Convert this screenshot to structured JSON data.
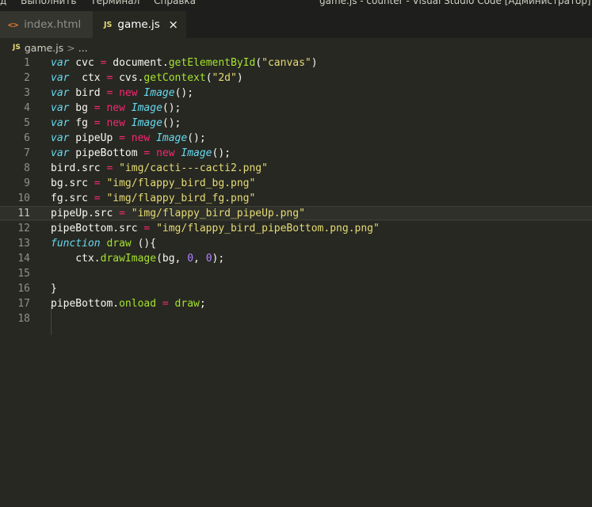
{
  "titlebar": {
    "menu": [
      "д",
      "Выполнить",
      "Терминал",
      "Справка"
    ],
    "window_title": "game.js - counter - Visual Studio Code [Администратор]"
  },
  "tabs": [
    {
      "label": "index.html",
      "icon": "html-file-icon",
      "active": false
    },
    {
      "label": "game.js",
      "icon": "js-file-icon",
      "active": true
    }
  ],
  "breadcrumb": {
    "file": "game.js",
    "icon_text": "JS",
    "sep": ">",
    "rest": "..."
  },
  "file_icons": {
    "html": "<>",
    "js": "JS",
    "close": "×"
  },
  "editor": {
    "current_line": 11,
    "lines": [
      {
        "n": "1",
        "tokens": [
          [
            "k",
            "var"
          ],
          [
            "p",
            " cvc "
          ],
          [
            "o",
            "="
          ],
          [
            "p",
            " document."
          ],
          [
            "f",
            "getElementById"
          ],
          [
            "p",
            "("
          ],
          [
            "s",
            "\"canvas\""
          ],
          [
            "p",
            ")"
          ]
        ]
      },
      {
        "n": "2",
        "tokens": [
          [
            "k",
            "var"
          ],
          [
            "p",
            "  ctx "
          ],
          [
            "o",
            "="
          ],
          [
            "p",
            " cvs."
          ],
          [
            "f",
            "getContext"
          ],
          [
            "p",
            "("
          ],
          [
            "s",
            "\"2d\""
          ],
          [
            "p",
            ")"
          ]
        ]
      },
      {
        "n": "3",
        "tokens": [
          [
            "k",
            "var"
          ],
          [
            "p",
            " bird "
          ],
          [
            "o",
            "="
          ],
          [
            "p",
            " "
          ],
          [
            "n",
            "new"
          ],
          [
            "p",
            " "
          ],
          [
            "c",
            "Image"
          ],
          [
            "p",
            "();"
          ]
        ]
      },
      {
        "n": "4",
        "tokens": [
          [
            "k",
            "var"
          ],
          [
            "p",
            " bg "
          ],
          [
            "o",
            "="
          ],
          [
            "p",
            " "
          ],
          [
            "n",
            "new"
          ],
          [
            "p",
            " "
          ],
          [
            "c",
            "Image"
          ],
          [
            "p",
            "();"
          ]
        ]
      },
      {
        "n": "5",
        "tokens": [
          [
            "k",
            "var"
          ],
          [
            "p",
            " fg "
          ],
          [
            "o",
            "="
          ],
          [
            "p",
            " "
          ],
          [
            "n",
            "new"
          ],
          [
            "p",
            " "
          ],
          [
            "c",
            "Image"
          ],
          [
            "p",
            "();"
          ]
        ]
      },
      {
        "n": "6",
        "tokens": [
          [
            "k",
            "var"
          ],
          [
            "p",
            " pipeUp "
          ],
          [
            "o",
            "="
          ],
          [
            "p",
            " "
          ],
          [
            "n",
            "new"
          ],
          [
            "p",
            " "
          ],
          [
            "c",
            "Image"
          ],
          [
            "p",
            "();"
          ]
        ]
      },
      {
        "n": "7",
        "tokens": [
          [
            "k",
            "var"
          ],
          [
            "p",
            " pipeBottom "
          ],
          [
            "o",
            "="
          ],
          [
            "p",
            " "
          ],
          [
            "n",
            "new"
          ],
          [
            "p",
            " "
          ],
          [
            "c",
            "Image"
          ],
          [
            "p",
            "();"
          ]
        ]
      },
      {
        "n": "8",
        "tokens": [
          [
            "p",
            "bird.src "
          ],
          [
            "o",
            "="
          ],
          [
            "p",
            " "
          ],
          [
            "s",
            "\"img/cacti---cacti2.png\""
          ]
        ]
      },
      {
        "n": "9",
        "tokens": [
          [
            "p",
            "bg.src "
          ],
          [
            "o",
            "="
          ],
          [
            "p",
            " "
          ],
          [
            "s",
            "\"img/flappy_bird_bg.png\""
          ]
        ]
      },
      {
        "n": "10",
        "tokens": [
          [
            "p",
            "fg.src "
          ],
          [
            "o",
            "="
          ],
          [
            "p",
            " "
          ],
          [
            "s",
            "\"img/flappy_bird_fg.png\""
          ]
        ]
      },
      {
        "n": "11",
        "tokens": [
          [
            "p",
            "pipeUp.src "
          ],
          [
            "o",
            "="
          ],
          [
            "p",
            " "
          ],
          [
            "s",
            "\"img/flappy_bird_pipeUp.png\""
          ]
        ]
      },
      {
        "n": "12",
        "tokens": [
          [
            "p",
            "pipeBottom.src "
          ],
          [
            "o",
            "="
          ],
          [
            "p",
            " "
          ],
          [
            "s",
            "\"img/flappy_bird_pipeBottom.png.png\""
          ]
        ]
      },
      {
        "n": "13",
        "tokens": [
          [
            "k",
            "function"
          ],
          [
            "p",
            " "
          ],
          [
            "f",
            "draw"
          ],
          [
            "p",
            " (){"
          ]
        ]
      },
      {
        "n": "14",
        "tokens": [
          [
            "p",
            "    ctx."
          ],
          [
            "f",
            "drawImage"
          ],
          [
            "p",
            "(bg, "
          ],
          [
            "num",
            "0"
          ],
          [
            "p",
            ", "
          ],
          [
            "num",
            "0"
          ],
          [
            "p",
            ");"
          ]
        ]
      },
      {
        "n": "15",
        "tokens": []
      },
      {
        "n": "16",
        "tokens": [
          [
            "p",
            "}"
          ]
        ]
      },
      {
        "n": "17",
        "tokens": [
          [
            "p",
            "pipeBottom."
          ],
          [
            "f",
            "onload"
          ],
          [
            "p",
            " "
          ],
          [
            "o",
            "="
          ],
          [
            "p",
            " "
          ],
          [
            "f",
            "draw"
          ],
          [
            "p",
            ";"
          ]
        ]
      },
      {
        "n": "18",
        "tokens": []
      }
    ]
  }
}
